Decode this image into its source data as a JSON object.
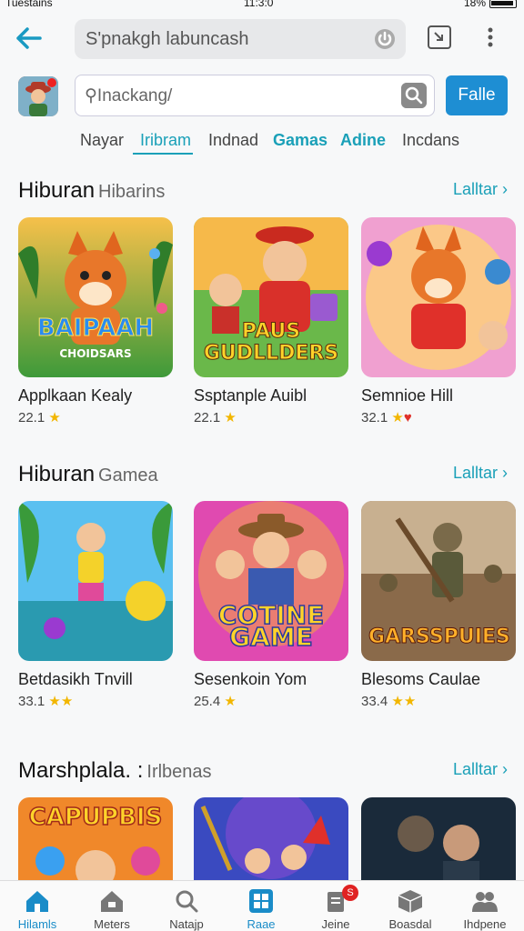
{
  "status": {
    "left": "Tuestains",
    "center": "11:3:0",
    "right": "18%"
  },
  "topbar": {
    "url_text": "S'pnakgh labuncash"
  },
  "search": {
    "placeholder": "Inackang/",
    "filter_label": "Falle"
  },
  "tabs": [
    {
      "label": "Nayar"
    },
    {
      "label": "Iribram"
    },
    {
      "label": "Indnad"
    },
    {
      "label": "Gamas"
    },
    {
      "label": "Adine"
    },
    {
      "label": "Incdans"
    }
  ],
  "sections": [
    {
      "title": "Hiburan",
      "subtitle": "Hibarins",
      "more": "Lalltar",
      "cards": [
        {
          "name": "Applkaan Kealy",
          "rating": "22.1",
          "logo": "BAIPAAH",
          "logo_sub": "CHOIDSARS"
        },
        {
          "name": "Ssptanple Auibl",
          "rating": "22.1",
          "logo": "PAUS GUDLLDERS"
        },
        {
          "name": "Semnioe Hill",
          "rating": "32.1",
          "logo": ""
        }
      ]
    },
    {
      "title": "Hiburan",
      "subtitle": "Gamea",
      "more": "Lalltar",
      "cards": [
        {
          "name": "Betdasikh Tnvill",
          "rating": "33.1",
          "logo": ""
        },
        {
          "name": "Sesenkoin Yom",
          "rating": "25.4",
          "logo": "COTINE GAME"
        },
        {
          "name": "Blesoms Caulae",
          "rating": "33.4",
          "logo": "GARSSPUIES"
        }
      ]
    },
    {
      "title": "Marshplala. :",
      "subtitle": "Irlbenas",
      "more": "Lalltar",
      "cards": [
        {
          "logo": "CAPUPBIS"
        },
        {
          "logo": ""
        },
        {
          "logo": ""
        }
      ]
    }
  ],
  "bottom_nav": [
    {
      "label": "Hilamls"
    },
    {
      "label": "Meters"
    },
    {
      "label": "Natajp"
    },
    {
      "label": "Raae"
    },
    {
      "label": "Jeine",
      "badge": "S"
    },
    {
      "label": "Boasdal"
    },
    {
      "label": "Ihdpene"
    }
  ],
  "colors": {
    "accent": "#1aa0b8",
    "button": "#1e8ed3"
  }
}
